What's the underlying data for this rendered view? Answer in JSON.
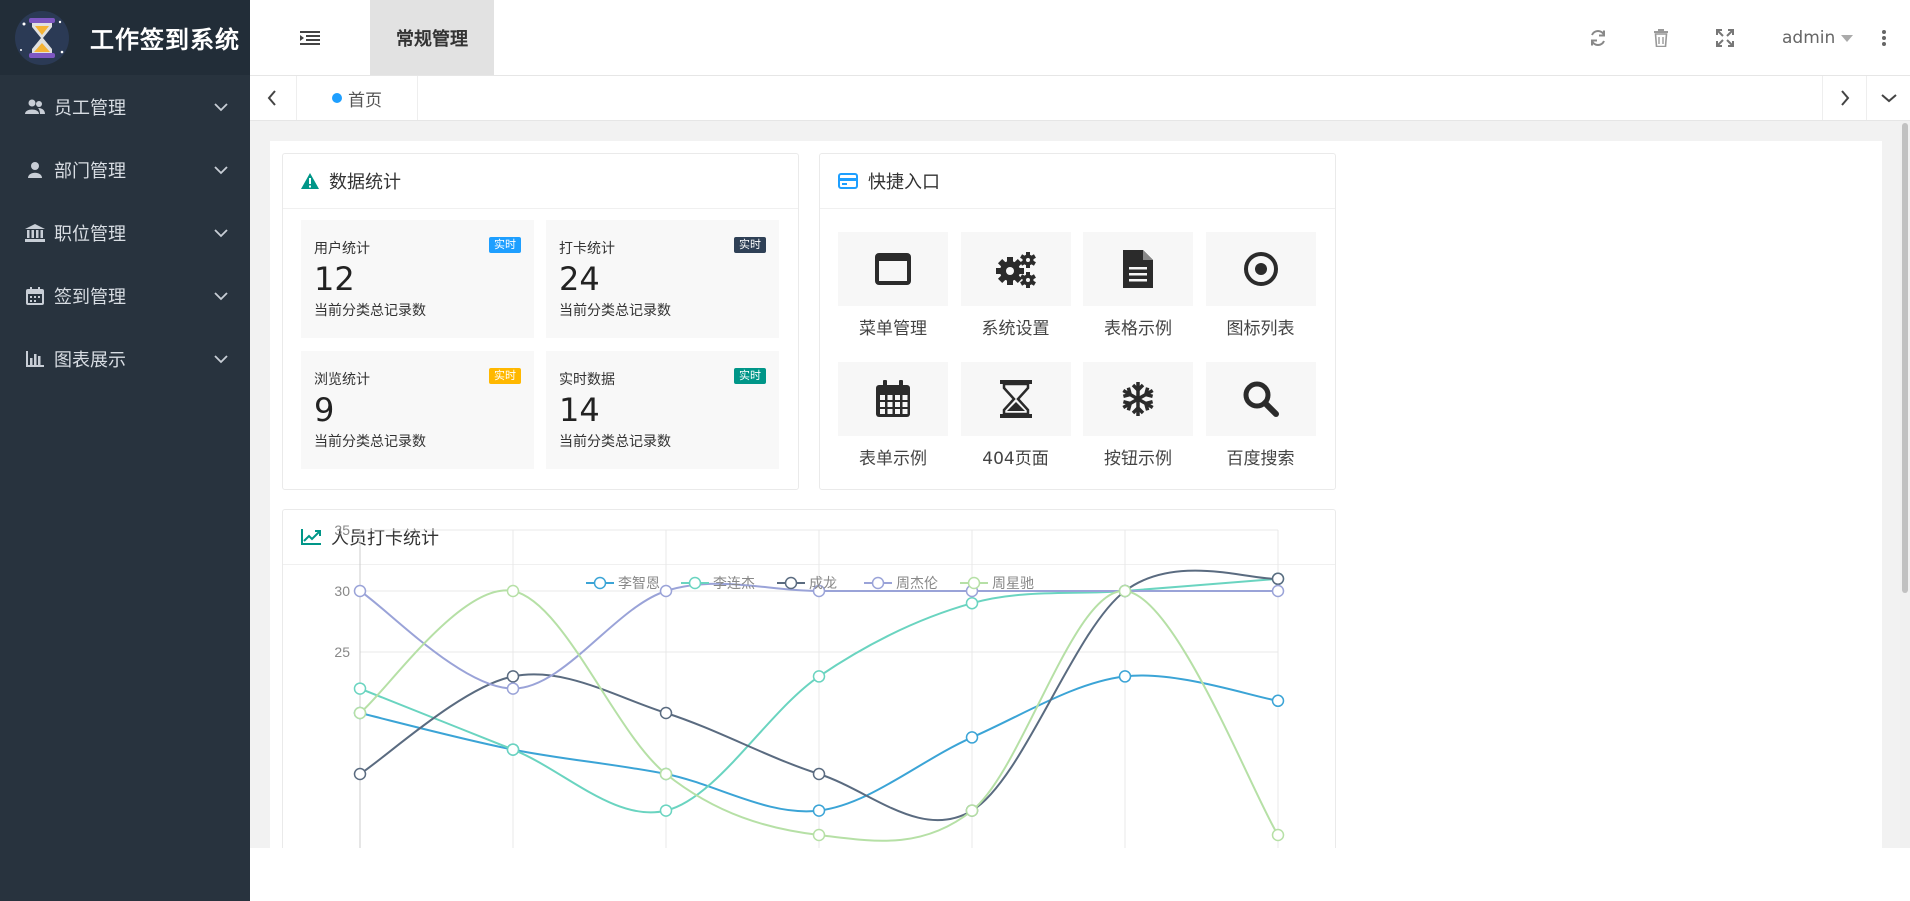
{
  "app": {
    "title": "工作签到系统"
  },
  "sidebar": {
    "items": [
      {
        "label": "员工管理",
        "icon": "users-icon"
      },
      {
        "label": "部门管理",
        "icon": "user-icon"
      },
      {
        "label": "职位管理",
        "icon": "bank-icon"
      },
      {
        "label": "签到管理",
        "icon": "calendar-icon"
      },
      {
        "label": "图表展示",
        "icon": "bar-chart-icon"
      }
    ]
  },
  "header": {
    "tab": "常规管理",
    "user": "admin",
    "icons": [
      "refresh-icon",
      "trash-icon",
      "fullscreen-icon",
      "more-vertical-icon"
    ]
  },
  "tabbar": {
    "home": "首页"
  },
  "stats": {
    "title": "数据统计",
    "items": [
      {
        "title": "用户统计",
        "badge": "实时",
        "badge_color": "#1e9fff",
        "value": "12",
        "sub": "当前分类总记录数"
      },
      {
        "title": "打卡统计",
        "badge": "实时",
        "badge_color": "#2f4056",
        "value": "24",
        "sub": "当前分类总记录数"
      },
      {
        "title": "浏览统计",
        "badge": "实时",
        "badge_color": "#ffb800",
        "value": "9",
        "sub": "当前分类总记录数"
      },
      {
        "title": "实时数据",
        "badge": "实时",
        "badge_color": "#009688",
        "value": "14",
        "sub": "当前分类总记录数"
      }
    ]
  },
  "quick": {
    "title": "快捷入口",
    "items": [
      {
        "label": "菜单管理",
        "icon": "window-icon"
      },
      {
        "label": "系统设置",
        "icon": "gears-icon"
      },
      {
        "label": "表格示例",
        "icon": "file-text-icon"
      },
      {
        "label": "图标列表",
        "icon": "dot-circle-icon"
      },
      {
        "label": "表单示例",
        "icon": "calendar-icon"
      },
      {
        "label": "404页面",
        "icon": "hourglass-icon"
      },
      {
        "label": "按钮示例",
        "icon": "snowflake-icon"
      },
      {
        "label": "百度搜索",
        "icon": "search-icon"
      }
    ]
  },
  "chart_card": {
    "title": "人员打卡统计"
  },
  "chart_data": {
    "type": "line",
    "ylim": [
      0,
      35
    ],
    "y_ticks": [
      "35",
      "30",
      "25"
    ],
    "x_count": 7,
    "series": [
      {
        "name": "李智恩",
        "color": "#3ba4d6",
        "values": [
          20,
          17,
          15,
          12,
          18,
          23,
          21
        ]
      },
      {
        "name": "李连杰",
        "color": "#6ad4c0",
        "values": [
          22,
          17,
          12,
          23,
          29,
          30,
          31
        ]
      },
      {
        "name": "成龙",
        "color": "#5a6b80",
        "values": [
          15,
          23,
          20,
          15,
          12,
          30,
          31
        ]
      },
      {
        "name": "周杰伦",
        "color": "#9aa3d8",
        "values": [
          30,
          22,
          30,
          30,
          30,
          30,
          30
        ]
      },
      {
        "name": "周星驰",
        "color": "#b6e0a6",
        "values": [
          20,
          30,
          15,
          10,
          12,
          30,
          10
        ]
      }
    ]
  }
}
